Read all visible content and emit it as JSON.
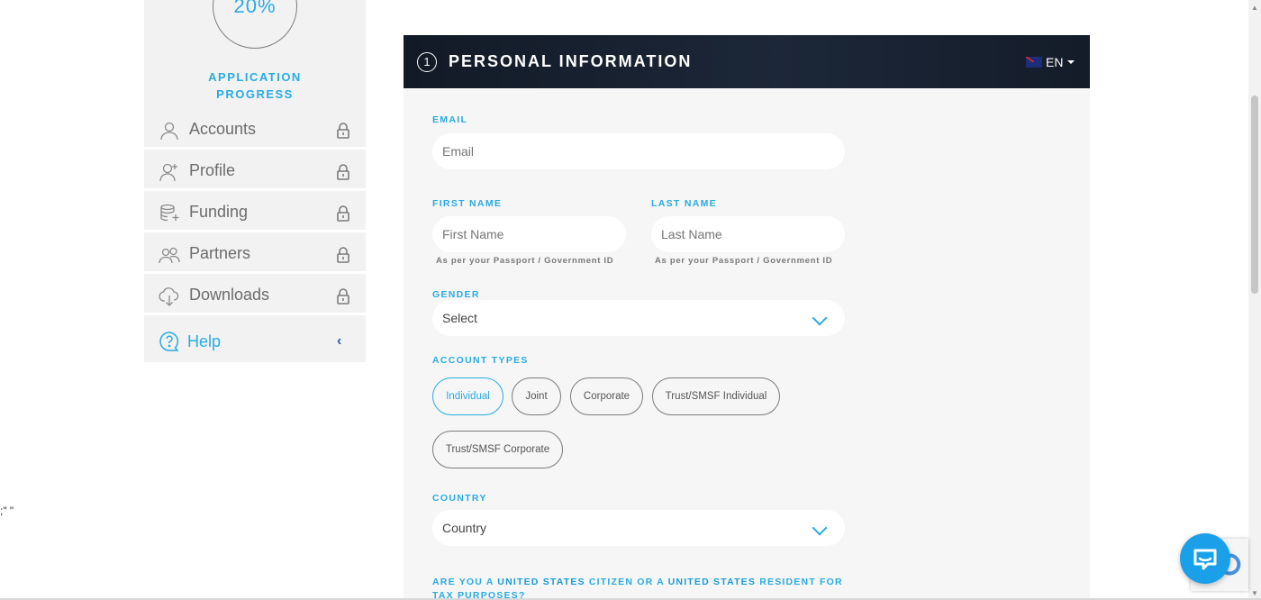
{
  "sidebar": {
    "progress_pct": "20%",
    "progress_title_1": "APPLICATION",
    "progress_title_2": "PROGRESS",
    "items": [
      {
        "label": "Accounts"
      },
      {
        "label": "Profile"
      },
      {
        "label": "Funding"
      },
      {
        "label": "Partners"
      },
      {
        "label": "Downloads"
      },
      {
        "label": "Help"
      }
    ]
  },
  "form": {
    "step_number": "1",
    "title": "PERSONAL INFORMATION",
    "language": "EN",
    "email": {
      "label": "EMAIL",
      "placeholder": "Email"
    },
    "first_name": {
      "label": "FIRST NAME",
      "placeholder": "First Name",
      "helper": "As per your Passport / Government ID"
    },
    "last_name": {
      "label": "LAST NAME",
      "placeholder": "Last Name",
      "helper": "As per your Passport / Government ID"
    },
    "gender": {
      "label": "GENDER",
      "value": "Select"
    },
    "account_types": {
      "label": "ACCOUNT TYPES",
      "options": [
        "Individual",
        "Joint",
        "Corporate",
        "Trust/SMSF Individual",
        "Trust/SMSF Corporate"
      ],
      "selected": "Individual"
    },
    "country": {
      "label": "COUNTRY",
      "value": "Country"
    },
    "us_question": {
      "part1": "ARE YOU A ",
      "part2": "UNITED STATES",
      "part3": " CITIZEN OR A ",
      "part4": "UNITED STATES",
      "part5": " RESIDENT FOR TAX PURPOSES?"
    }
  },
  "stray_text": ";\" \"",
  "colors": {
    "accent": "#29abe2",
    "header_bg": "#141c29",
    "card_bg": "#f6f6f6"
  }
}
